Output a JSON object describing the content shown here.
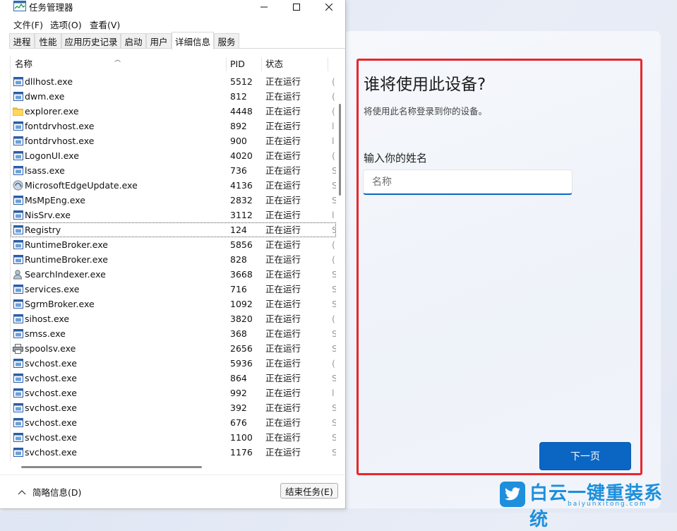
{
  "task_manager": {
    "title": "任务管理器",
    "menu": [
      "文件(F)",
      "选项(O)",
      "查看(V)"
    ],
    "tabs": [
      "进程",
      "性能",
      "应用历史记录",
      "启动",
      "用户",
      "详细信息",
      "服务"
    ],
    "active_tab": "详细信息",
    "columns": {
      "name": "名称",
      "pid": "PID",
      "status": "状态"
    },
    "rows": [
      {
        "name": "dllhost.exe",
        "pid": "5512",
        "status": "正在运行",
        "icon": "app-window-icon",
        "extra": "("
      },
      {
        "name": "dwm.exe",
        "pid": "812",
        "status": "正在运行",
        "icon": "app-window-icon",
        "extra": "("
      },
      {
        "name": "explorer.exe",
        "pid": "4448",
        "status": "正在运行",
        "icon": "folder-icon",
        "extra": "("
      },
      {
        "name": "fontdrvhost.exe",
        "pid": "892",
        "status": "正在运行",
        "icon": "app-window-icon",
        "extra": "l"
      },
      {
        "name": "fontdrvhost.exe",
        "pid": "900",
        "status": "正在运行",
        "icon": "app-window-icon",
        "extra": "l"
      },
      {
        "name": "LogonUI.exe",
        "pid": "4020",
        "status": "正在运行",
        "icon": "app-window-icon",
        "extra": "("
      },
      {
        "name": "lsass.exe",
        "pid": "736",
        "status": "正在运行",
        "icon": "app-window-icon",
        "extra": "S"
      },
      {
        "name": "MicrosoftEdgeUpdate.exe",
        "pid": "4136",
        "status": "正在运行",
        "icon": "edge-update-icon",
        "extra": "S"
      },
      {
        "name": "MsMpEng.exe",
        "pid": "2832",
        "status": "正在运行",
        "icon": "app-window-icon",
        "extra": "S"
      },
      {
        "name": "NisSrv.exe",
        "pid": "3112",
        "status": "正在运行",
        "icon": "app-window-icon",
        "extra": "l"
      },
      {
        "name": "Registry",
        "pid": "124",
        "status": "正在运行",
        "icon": "app-window-icon",
        "extra": "S"
      },
      {
        "name": "RuntimeBroker.exe",
        "pid": "5856",
        "status": "正在运行",
        "icon": "app-window-icon",
        "extra": "("
      },
      {
        "name": "RuntimeBroker.exe",
        "pid": "828",
        "status": "正在运行",
        "icon": "app-window-icon",
        "extra": "("
      },
      {
        "name": "SearchIndexer.exe",
        "pid": "3668",
        "status": "正在运行",
        "icon": "search-indexer-icon",
        "extra": "S"
      },
      {
        "name": "services.exe",
        "pid": "716",
        "status": "正在运行",
        "icon": "app-window-icon",
        "extra": "S"
      },
      {
        "name": "SgrmBroker.exe",
        "pid": "1092",
        "status": "正在运行",
        "icon": "app-window-icon",
        "extra": "S"
      },
      {
        "name": "sihost.exe",
        "pid": "3820",
        "status": "正在运行",
        "icon": "app-window-icon",
        "extra": "("
      },
      {
        "name": "smss.exe",
        "pid": "368",
        "status": "正在运行",
        "icon": "app-window-icon",
        "extra": "S"
      },
      {
        "name": "spoolsv.exe",
        "pid": "2656",
        "status": "正在运行",
        "icon": "printer-icon",
        "extra": "S"
      },
      {
        "name": "svchost.exe",
        "pid": "5936",
        "status": "正在运行",
        "icon": "app-window-icon",
        "extra": "("
      },
      {
        "name": "svchost.exe",
        "pid": "864",
        "status": "正在运行",
        "icon": "app-window-icon",
        "extra": "S"
      },
      {
        "name": "svchost.exe",
        "pid": "992",
        "status": "正在运行",
        "icon": "app-window-icon",
        "extra": "l"
      },
      {
        "name": "svchost.exe",
        "pid": "392",
        "status": "正在运行",
        "icon": "app-window-icon",
        "extra": "S"
      },
      {
        "name": "svchost.exe",
        "pid": "676",
        "status": "正在运行",
        "icon": "app-window-icon",
        "extra": "S"
      },
      {
        "name": "svchost.exe",
        "pid": "1100",
        "status": "正在运行",
        "icon": "app-window-icon",
        "extra": "S"
      },
      {
        "name": "svchost.exe",
        "pid": "1176",
        "status": "正在运行",
        "icon": "app-window-icon",
        "extra": "S"
      }
    ],
    "focused_row": "Registry",
    "footer": {
      "less_info": "简略信息(D)",
      "end_task": "结束任务(E)"
    }
  },
  "oobe": {
    "title": "谁将使用此设备?",
    "subtitle": "将使用此名称登录到你的设备。",
    "name_label": "输入你的姓名",
    "name_placeholder": "名称",
    "name_value": "",
    "next_button": "下一页",
    "highlight_color": "#e8262c",
    "accent_color": "#0b66c3"
  },
  "watermark": {
    "text": "白云一键重装系统",
    "url": "baiyunxitong.com"
  }
}
